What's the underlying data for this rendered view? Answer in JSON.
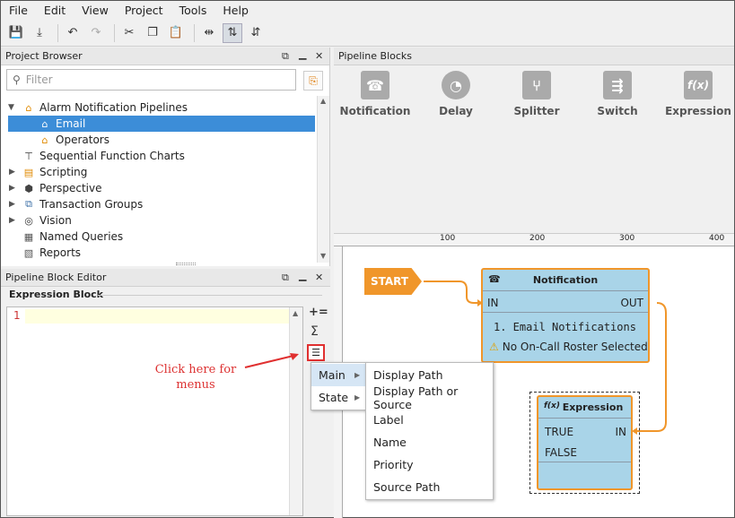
{
  "menubar": {
    "items": [
      "File",
      "Edit",
      "View",
      "Project",
      "Tools",
      "Help"
    ]
  },
  "project_browser": {
    "title": "Project Browser",
    "filter_placeholder": "Filter",
    "tree": [
      {
        "label": "Alarm Notification Pipelines"
      },
      {
        "label": "Email"
      },
      {
        "label": "Operators"
      },
      {
        "label": "Sequential Function Charts"
      },
      {
        "label": "Scripting"
      },
      {
        "label": "Perspective"
      },
      {
        "label": "Transaction Groups"
      },
      {
        "label": "Vision"
      },
      {
        "label": "Named Queries"
      },
      {
        "label": "Reports"
      }
    ]
  },
  "editor": {
    "title": "Pipeline Block Editor",
    "section": "Expression Block",
    "line_number": "1",
    "annotation": "Click here for menus"
  },
  "pipeline_blocks": {
    "title": "Pipeline Blocks",
    "items": [
      "Notification",
      "Delay",
      "Splitter",
      "Switch",
      "Expression"
    ]
  },
  "canvas": {
    "ruler_labels": [
      "100",
      "200",
      "300",
      "400"
    ],
    "start_label": "START",
    "notification": {
      "title": "Notification",
      "in": "IN",
      "out": "OUT",
      "line1": "1. Email Notifications",
      "warning": "No On-Call Roster Selected"
    },
    "expression": {
      "title": "Expression",
      "icon": "f(x)",
      "true": "TRUE",
      "false": "FALSE",
      "in": "IN"
    }
  },
  "context_menu": {
    "items": [
      "Main",
      "State"
    ],
    "submenu": [
      "Display Path",
      "Display Path or Source",
      "Label",
      "Name",
      "Priority",
      "Source Path"
    ]
  },
  "colors": {
    "accent": "#3c8dd8",
    "orange": "#f0a030",
    "node_fill": "#a9d4e8",
    "annotation_red": "#d33"
  }
}
